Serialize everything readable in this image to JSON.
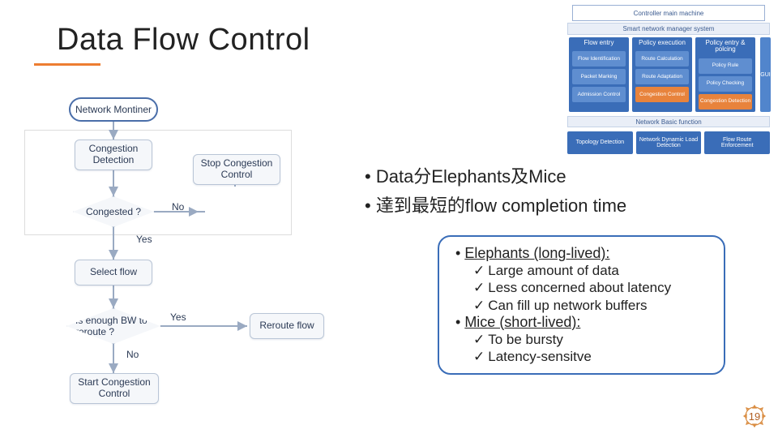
{
  "title": "Data Flow Control",
  "flow": {
    "start": "Network Montiner",
    "cong_detect": "Congestion Detection",
    "stop_cc": "Stop Congestion Control",
    "congested_q": "Congested ?",
    "no": "No",
    "yes": "Yes",
    "select_flow": "Select flow",
    "enough_bw_q": "Is enough BW to reroute ?",
    "yes2": "Yes",
    "no2": "No",
    "reroute": "Reroute flow",
    "start_cc": "Start Congestion Control"
  },
  "arch": {
    "controller": "Controller main machine",
    "sns": "Smart network manager system",
    "cols": [
      {
        "head": "Flow entry",
        "cells": [
          "Flow Identification",
          "Packet Marking",
          "Admission Control"
        ],
        "orange_idx": -1
      },
      {
        "head": "Policy execution",
        "cells": [
          "Route Calculation",
          "Route Adaptation",
          "Congestion Control"
        ],
        "orange_idx": 2
      },
      {
        "head": "Policy entry & polcing",
        "cells": [
          "Policy Rule",
          "Policy Checking",
          "Congestion Detection"
        ],
        "orange_idx": 2
      }
    ],
    "gui": "GUI",
    "nbf": "Network Basic function",
    "bottom": [
      "Topology Detection",
      "Network Dynamic Load Detection",
      "Flow Route Enforcement"
    ]
  },
  "bullets": {
    "b1": "Data分Elephants及Mice",
    "b2": "達到最短的flow completion time"
  },
  "callout": {
    "l1": "Elephants (long-lived):",
    "e1": "Large amount of data",
    "e2": "Less concerned about latency",
    "e3": "Can fill up network buffers",
    "l2": "Mice (short-lived):",
    "m1": "To be bursty",
    "m2": "Latency-sensitve"
  },
  "pageno": "19"
}
